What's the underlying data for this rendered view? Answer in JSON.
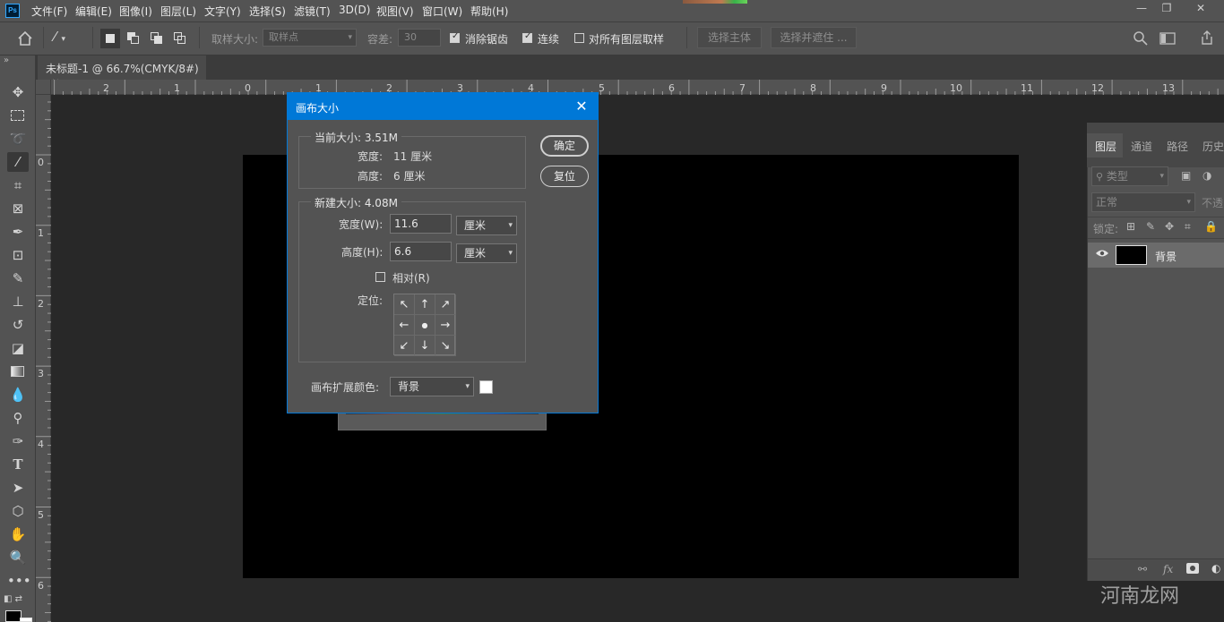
{
  "menubar": {
    "logo": "Ps",
    "items": [
      "文件(F)",
      "编辑(E)",
      "图像(I)",
      "图层(L)",
      "文字(Y)",
      "选择(S)",
      "滤镜(T)",
      "3D(D)",
      "视图(V)",
      "窗口(W)",
      "帮助(H)"
    ],
    "window_controls": [
      "—",
      "❐",
      "✕"
    ]
  },
  "options_bar": {
    "sample_size_label": "取样大小:",
    "sample_size_value": "取样点",
    "tolerance_label": "容差:",
    "tolerance_value": "30",
    "anti_alias_label": "消除锯齿",
    "contiguous_label": "连续",
    "sample_all_label": "对所有图层取样",
    "select_subject_label": "选择主体",
    "select_mask_label": "选择并遮住 ..."
  },
  "tabs": {
    "doc_tab_label": "未标题-1 @ 66.7%(CMYK/8#)",
    "close_glyph": "×",
    "expand_glyph": "»"
  },
  "ruler": {
    "h_labels": [
      "2",
      "1",
      "0",
      "1",
      "2",
      "3",
      "4",
      "5",
      "6",
      "7",
      "8",
      "9",
      "10",
      "11",
      "12",
      "13"
    ],
    "v_labels": [
      "0",
      "1",
      "2",
      "3",
      "4",
      "5",
      "6"
    ]
  },
  "dialog": {
    "title": "画布大小",
    "close_glyph": "✕",
    "current_size_label": "当前大小: 3.51M",
    "current_width_label": "宽度:",
    "current_width_value": "11 厘米",
    "current_height_label": "高度:",
    "current_height_value": "6 厘米",
    "new_size_label": "新建大小: 4.08M",
    "width_label": "宽度(W):",
    "width_value": "11.6",
    "width_unit": "厘米",
    "height_label": "高度(H):",
    "height_value": "6.6",
    "height_unit": "厘米",
    "relative_label": "相对(R)",
    "anchor_label": "定位:",
    "anchor_cells": [
      "↖",
      "↑",
      "↗",
      "←",
      "●",
      "→",
      "↙",
      "↓",
      "↘"
    ],
    "ext_color_label": "画布扩展颜色:",
    "ext_color_value": "背景",
    "ok_label": "确定",
    "reset_label": "复位"
  },
  "layers_panel": {
    "tabs": [
      "图层",
      "通道",
      "路径",
      "历史"
    ],
    "filter_placeholder": "类型",
    "blend_mode": "正常",
    "opacity_label": "不透",
    "lock_label": "锁定:",
    "layer_name": "背景",
    "footer_icons": [
      "link-icon",
      "fx-icon",
      "mask-icon",
      "adjustment-icon"
    ]
  },
  "watermark": "河南龙网",
  "colors": {
    "accent": "#0078d7",
    "panel_bg": "#535353",
    "canvas_bg": "#282828",
    "document_fill": "#000000"
  }
}
